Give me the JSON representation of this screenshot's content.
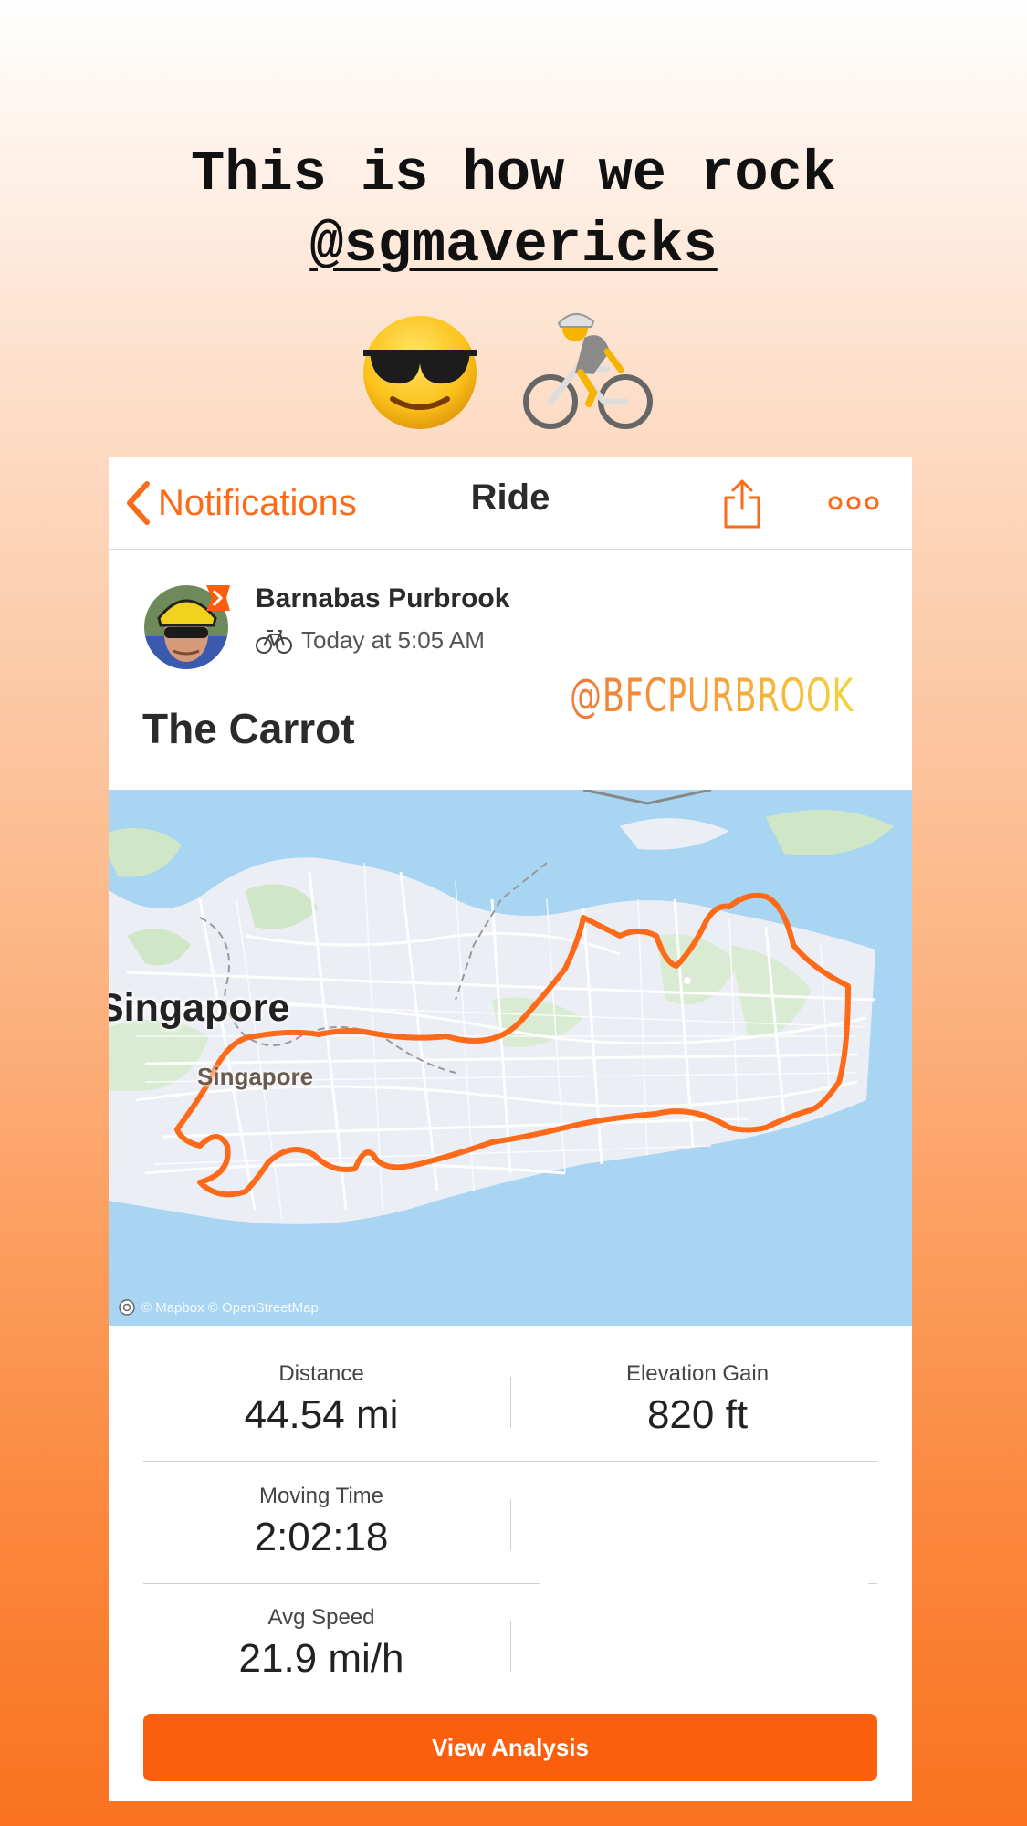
{
  "caption": {
    "line1": "This is how we rock",
    "mention": "@sgmavericks"
  },
  "emojis": [
    "smiling-face-with-sunglasses",
    "person-biking"
  ],
  "navbar": {
    "back_label": "Notifications",
    "title": "Ride",
    "share_icon": "share-icon",
    "more_icon": "more-icon"
  },
  "activity": {
    "athlete_name": "Barnabas Purbrook",
    "time": "Today at 5:05 AM",
    "title": "The Carrot",
    "sticker_handle": "@BFCPURBROOK"
  },
  "map": {
    "label_country": "Singapore",
    "label_city": "Singapore",
    "attribution": "© Mapbox © OpenStreetMap",
    "route_color": "#fc6a1a"
  },
  "stats": {
    "distance": {
      "label": "Distance",
      "value": "44.54 mi"
    },
    "elevation": {
      "label": "Elevation Gain",
      "value": "820 ft"
    },
    "moving_time": {
      "label": "Moving Time",
      "value": "2:02:18"
    },
    "avg_speed": {
      "label": "Avg Speed",
      "value": "21.9 mi/h"
    }
  },
  "cta": {
    "label": "View Analysis"
  },
  "colors": {
    "accent": "#fc5f0b",
    "text": "#2b2b2b"
  }
}
